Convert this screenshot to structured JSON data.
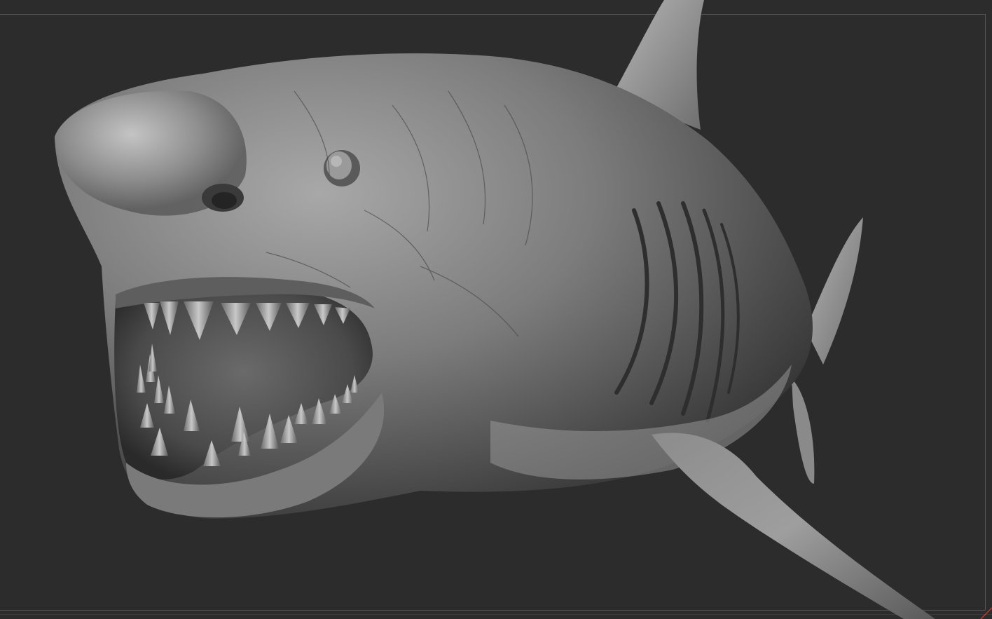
{
  "app": {
    "description_hidden": ""
  },
  "viewport": {
    "background_color": "#2c2c2c",
    "frame_color": "#555555",
    "model_base_color": "#8a8a8a",
    "model_highlight_color": "#d4d4d4",
    "model_shadow_color": "#1e1e1e",
    "corner_marker_color": "#c0392b"
  },
  "icons": {
    "corner_marker": "corner-marker-icon"
  }
}
